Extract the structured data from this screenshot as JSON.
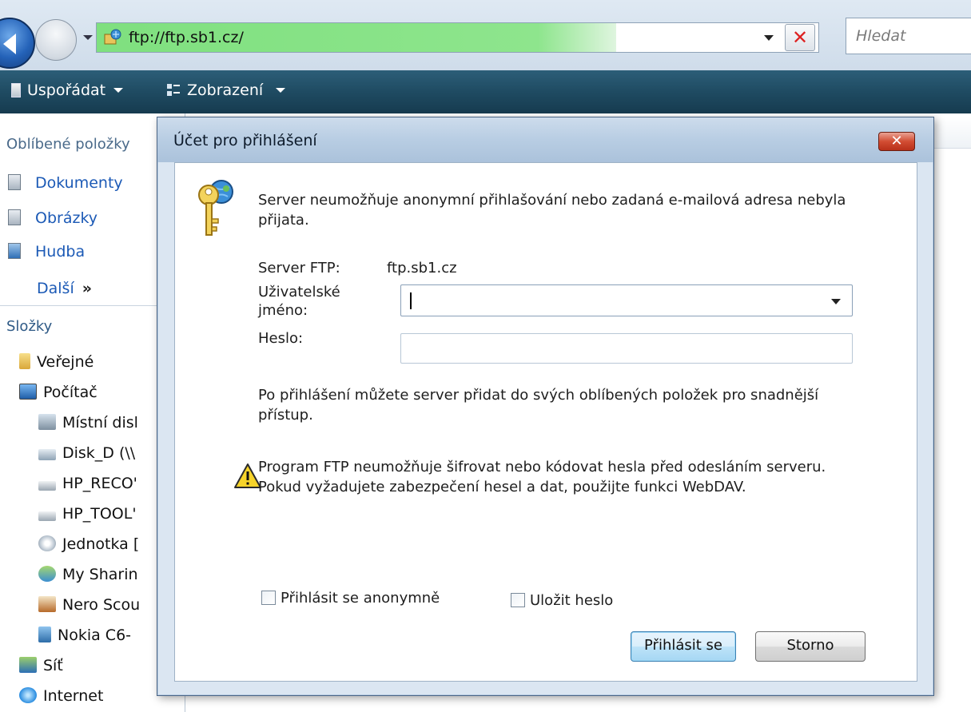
{
  "address_bar": {
    "url": "ftp://ftp.sb1.cz/",
    "search_placeholder": "Hledat",
    "progress": 0.72
  },
  "toolbar": {
    "organize_label": "Uspořádat",
    "views_label": "Zobrazení"
  },
  "nav_pane": {
    "favorites_heading": "Oblíbené položky",
    "favorites": [
      {
        "label": "Dokumenty",
        "icon": "documents-icon"
      },
      {
        "label": "Obrázky",
        "icon": "pictures-icon"
      },
      {
        "label": "Hudba",
        "icon": "music-icon"
      }
    ],
    "more_label": "Další",
    "more_glyph": "»",
    "folders_heading": "Složky",
    "folders": [
      {
        "label": "Veřejné",
        "icon": "folder-icon"
      },
      {
        "label": "Počítač",
        "icon": "computer-icon"
      },
      {
        "label": "Místní disl",
        "icon": "local-disk-icon"
      },
      {
        "label": "Disk_D (\\\\",
        "icon": "network-drive-icon"
      },
      {
        "label": "HP_RECO'",
        "icon": "drive-icon"
      },
      {
        "label": "HP_TOOL'",
        "icon": "drive-icon"
      },
      {
        "label": "Jednotka [",
        "icon": "optical-drive-icon"
      },
      {
        "label": "My Sharin",
        "icon": "sharing-icon"
      },
      {
        "label": "Nero Scou",
        "icon": "nero-scout-icon"
      },
      {
        "label": "Nokia C6-",
        "icon": "phone-icon"
      },
      {
        "label": "Síť",
        "icon": "network-icon"
      },
      {
        "label": "Internet",
        "icon": "internet-icon"
      }
    ]
  },
  "dialog": {
    "title": "Účet pro přihlášení",
    "close_glyph": "✕",
    "message_line1": "Server neumožňuje anonymní přihlašování nebo zadaná e-mailová adresa nebyla",
    "message_line2": "přijata.",
    "server_label": "Server FTP:",
    "server_value": "ftp.sb1.cz",
    "username_label_line1": "Uživatelské",
    "username_label_line2": "jméno:",
    "username_value": "",
    "password_label": "Heslo:",
    "password_value": "",
    "info_line1": "Po přihlášení můžete server přidat do svých oblíbených položek pro snadnější",
    "info_line2": "přístup.",
    "warning_line1": "Program FTP neumožňuje šifrovat nebo kódovat hesla před odesláním serveru.",
    "warning_line2": "Pokud vyžadujete zabezpečení hesel a dat, použijte funkci WebDAV.",
    "anonymous_label": "Přihlásit se anonymně",
    "anonymous_checked": false,
    "save_password_label": "Uložit heslo",
    "save_password_checked": false,
    "login_button": "Přihlásit se",
    "cancel_button": "Storno"
  }
}
